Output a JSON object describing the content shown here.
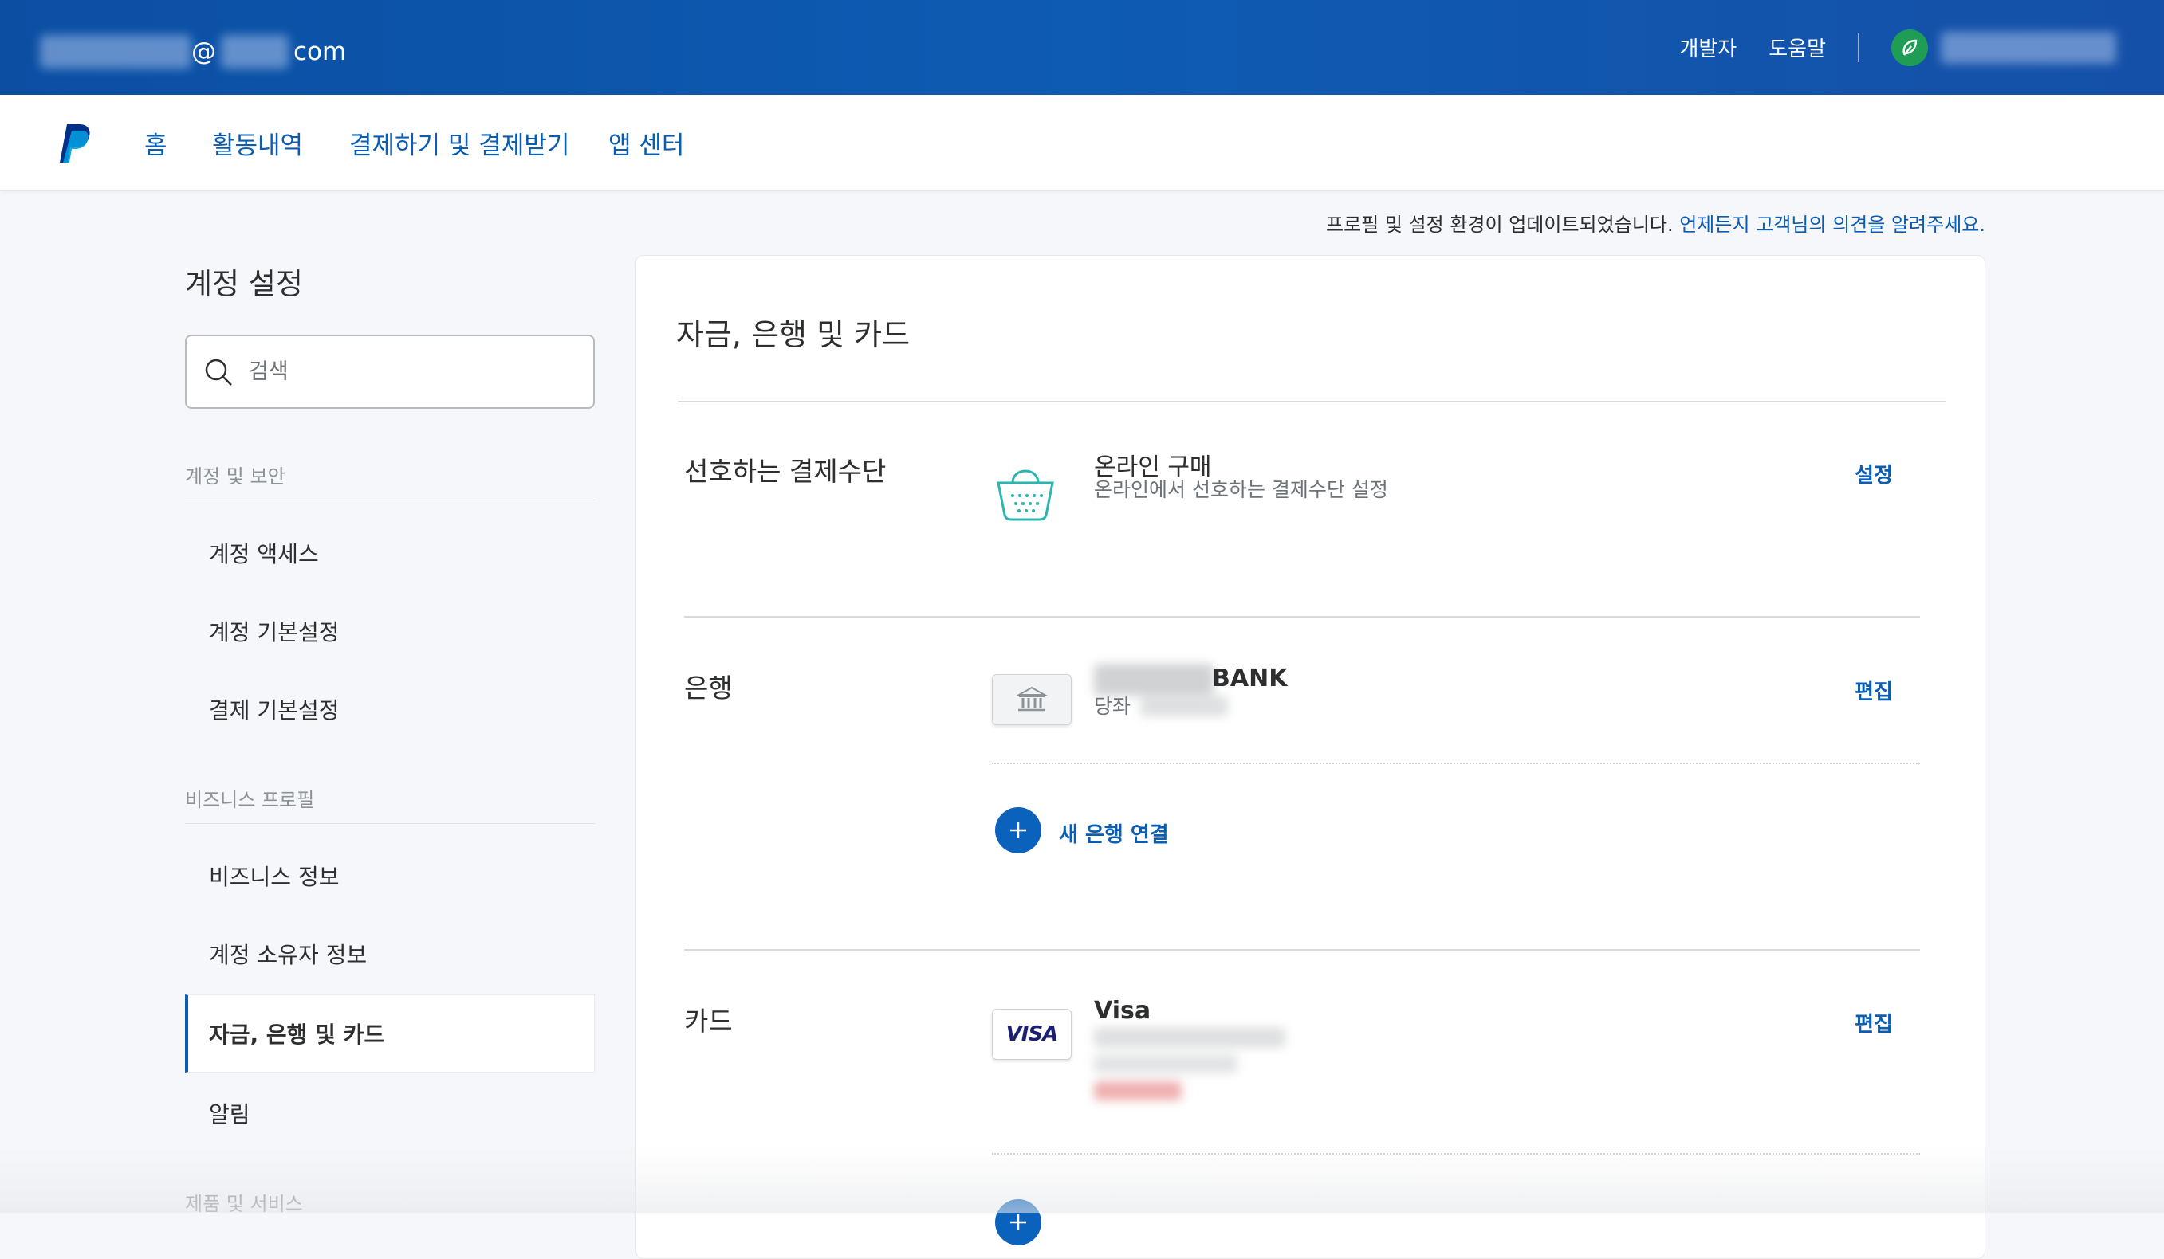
{
  "header": {
    "email_at": "@",
    "email_suffix": "com",
    "links": [
      "개발자",
      "도움말"
    ]
  },
  "nav": {
    "items": [
      "홈",
      "활동내역",
      "결제하기 및 결제받기",
      "앱 센터"
    ]
  },
  "notice": {
    "text": "프로필 및 설정 환경이 업데이트되었습니다. ",
    "link": "언제든지 고객님의 의견을 알려주세요."
  },
  "sidebar": {
    "title": "계정 설정",
    "search_placeholder": "검색",
    "sections": [
      {
        "label": "계정 및 보안",
        "items": [
          "계정 액세스",
          "계정 기본설정",
          "결제 기본설정"
        ]
      },
      {
        "label": "비즈니스 프로필",
        "items": [
          "비즈니스 정보",
          "계정 소유자 정보",
          "자금, 은행 및 카드",
          "알림"
        ]
      },
      {
        "label": "제품 및 서비스",
        "items": []
      }
    ],
    "active_item": "자금, 은행 및 카드"
  },
  "main": {
    "title": "자금, 은행 및 카드",
    "preferred": {
      "label": "선호하는 결제수단",
      "item_title": "온라인 구매",
      "item_sub": "온라인에서 선호하는 결제수단 설정",
      "action": "설정"
    },
    "bank": {
      "label": "은행",
      "name_suffix": "BANK",
      "account_type": "당좌",
      "action": "편집",
      "add_label": "새 은행 연결"
    },
    "card": {
      "label": "카드",
      "brand": "Visa",
      "logo_text": "VISA",
      "action": "편집"
    }
  },
  "colors": {
    "header_blue": "#0e5bb3",
    "link_blue": "#0b5db3",
    "avatar_green": "#1f9d55",
    "basket_teal": "#2bb5b0",
    "visa_navy": "#1a1f71"
  },
  "icons": {
    "search": "search-icon",
    "avatar": "leaf-avatar-icon",
    "paypal": "paypal-logo-icon",
    "basket": "shopping-basket-icon",
    "bank": "bank-building-icon",
    "add": "plus-icon"
  }
}
